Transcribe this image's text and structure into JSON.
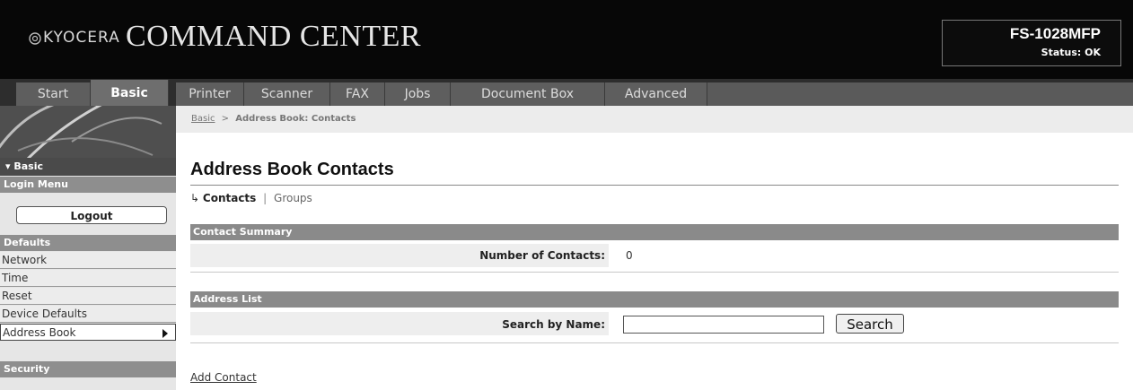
{
  "header": {
    "brand": "KYOCERA",
    "app_title": "COMMAND CENTER",
    "model": "FS-1028MFP",
    "status": "Status: OK"
  },
  "nav": {
    "tabs": [
      "Start",
      "Basic",
      "Printer",
      "Scanner",
      "FAX",
      "Jobs",
      "Document Box",
      "Advanced"
    ],
    "active": "Basic"
  },
  "sidebar": {
    "current": "▾ Basic",
    "login_menu": "Login Menu",
    "logout": "Logout",
    "defaults": "Defaults",
    "items": [
      "Network",
      "Time",
      "Reset",
      "Device Defaults",
      "Address Book"
    ],
    "security": "Security"
  },
  "breadcrumb": {
    "root": "Basic",
    "separator": ">",
    "current": "Address Book: Contacts"
  },
  "main": {
    "title": "Address Book Contacts",
    "subnav_arrow": "↳",
    "subnav_current": "Contacts",
    "subnav_divider": "|",
    "subnav_other": "Groups",
    "summary_header": "Contact Summary",
    "contacts_label": "Number of Contacts:",
    "contacts_value": "0",
    "address_list_header": "Address List",
    "search_label": "Search by Name:",
    "search_value": "",
    "search_button": "Search",
    "add_contact": "Add Contact"
  },
  "colors": {
    "header_bg": "#070707",
    "tab_bg": "#5e5e5e",
    "section_bar": "#8a8a8a",
    "sidebar_header": "#4a4a4a"
  }
}
